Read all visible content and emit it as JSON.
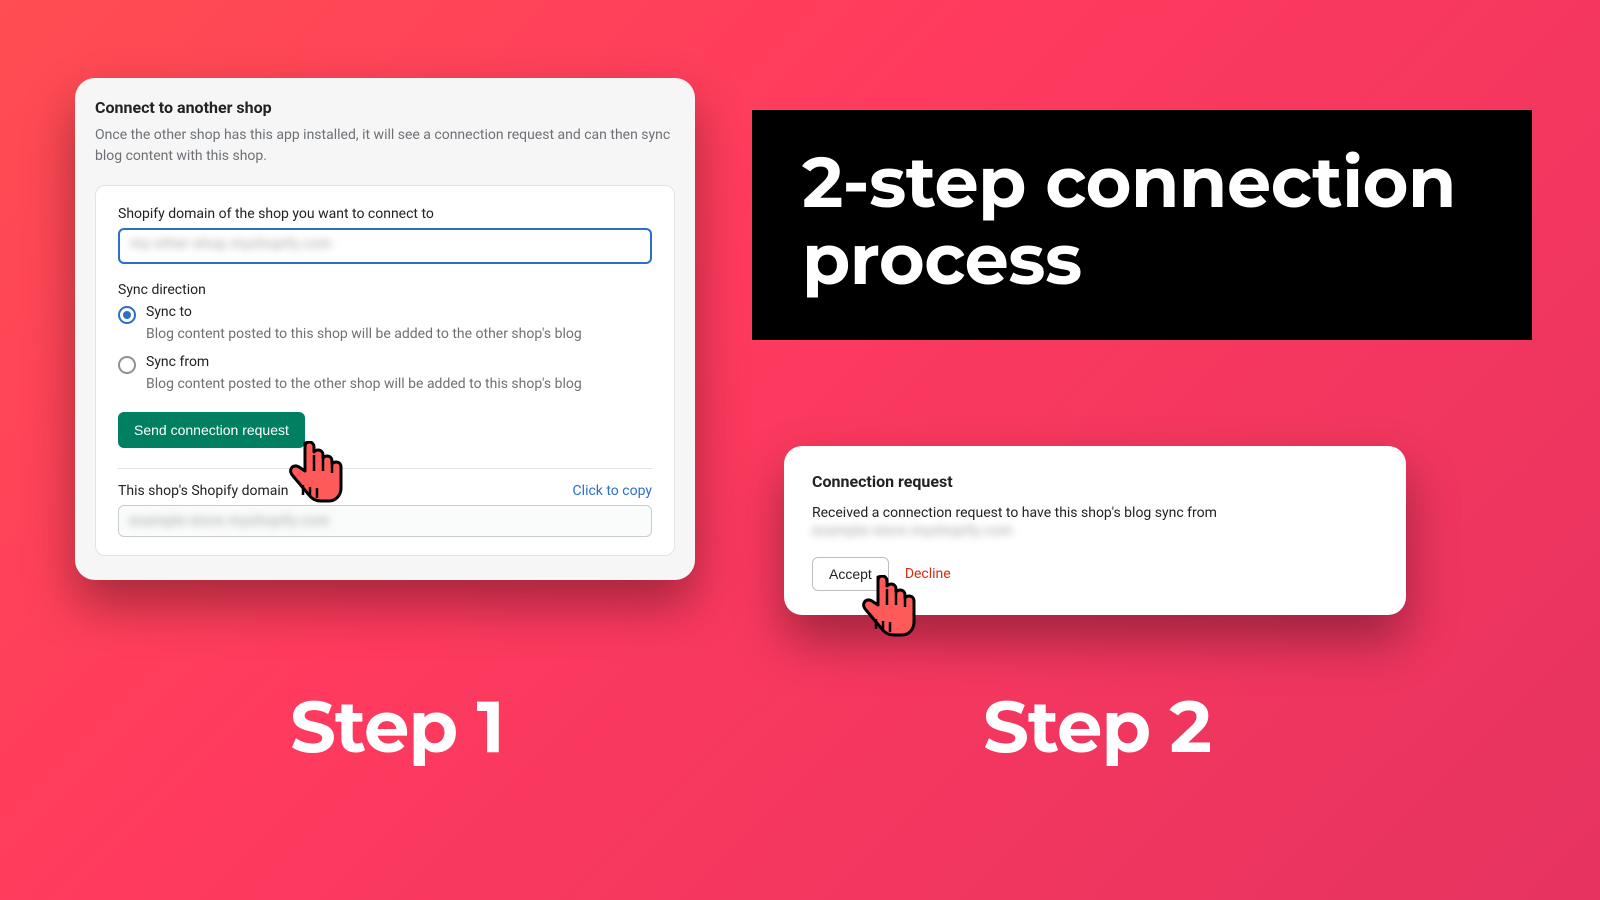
{
  "headline": {
    "line1": "2-step connection",
    "line2": "process"
  },
  "labels": {
    "step1": "Step 1",
    "step2": "Step 2"
  },
  "card1": {
    "title": "Connect to another shop",
    "subtitle": "Once the other shop has this app installed, it will see a connection request and can then sync blog content with this shop.",
    "domain_field_label": "Shopify domain of the shop you want to connect to",
    "domain_field_value": "my-other-shop.myshopify.com",
    "sync_direction_label": "Sync direction",
    "sync_to": {
      "label": "Sync to",
      "desc": "Blog content posted to this shop will be added to the other shop's blog",
      "checked": true
    },
    "sync_from": {
      "label": "Sync from",
      "desc": "Blog content posted to the other shop will be added to this shop's blog",
      "checked": false
    },
    "send_button": "Send connection request",
    "this_domain_label": "This shop's Shopify domain",
    "copy_link": "Click to copy",
    "this_domain_value": "example-store.myshopify.com"
  },
  "card2": {
    "title": "Connection request",
    "message": "Received a connection request to have this shop's blog sync from",
    "from_value": "example-store.myshopify.com",
    "accept": "Accept",
    "decline": "Decline"
  }
}
